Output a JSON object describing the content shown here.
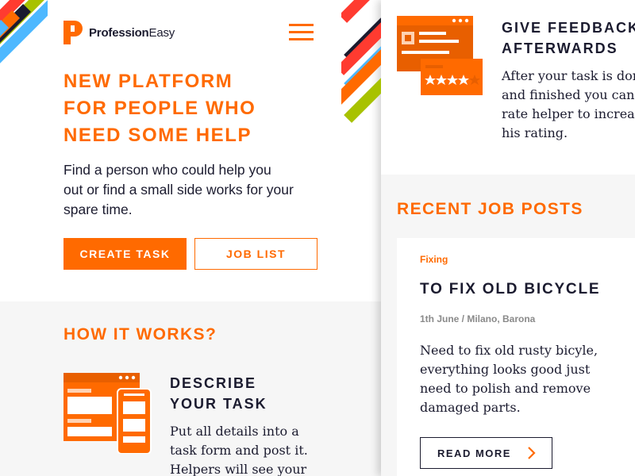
{
  "brand": {
    "name_bold": "Profession",
    "name_light": "Easy",
    "accent_color": "#ff6a00",
    "text_color": "#1b1b2f"
  },
  "header": {
    "menu_icon": "hamburger-menu-icon"
  },
  "hero": {
    "title_lines": [
      "NEW PLATFORM",
      "FOR PEOPLE WHO",
      "NEED SOME HELP"
    ],
    "subtitle": "Find a person who could help you out or find a small side works for your spare time.",
    "primary_button": "CREATE TASK",
    "secondary_button": "JOB LIST"
  },
  "how_it_works": {
    "title": "HOW IT WORKS?",
    "step": {
      "icon": "task-form-illustration",
      "title_lines": [
        "DESCRIBE",
        "YOUR TASK"
      ],
      "body_lines": [
        "Put all details into a",
        "task form and post it.",
        "Helpers will see your"
      ]
    }
  },
  "feedback": {
    "icon": "rating-illustration",
    "title_lines": [
      "GIVE FEEDBACK",
      "AFTERWARDS"
    ],
    "body_lines": [
      "After your task is done",
      "and finished you can",
      "rate helper to increase",
      "his rating."
    ]
  },
  "recent_jobs": {
    "title": "RECENT JOB POSTS",
    "job": {
      "category": "Fixing",
      "title": "TO FIX OLD BICYCLE",
      "meta": "1th June / Milano, Barona",
      "body": "Need to fix old rusty bicyle, everything looks good just need to polish and remove damaged parts.",
      "button": "READ MORE",
      "button_icon": "chevron-right-icon"
    }
  }
}
